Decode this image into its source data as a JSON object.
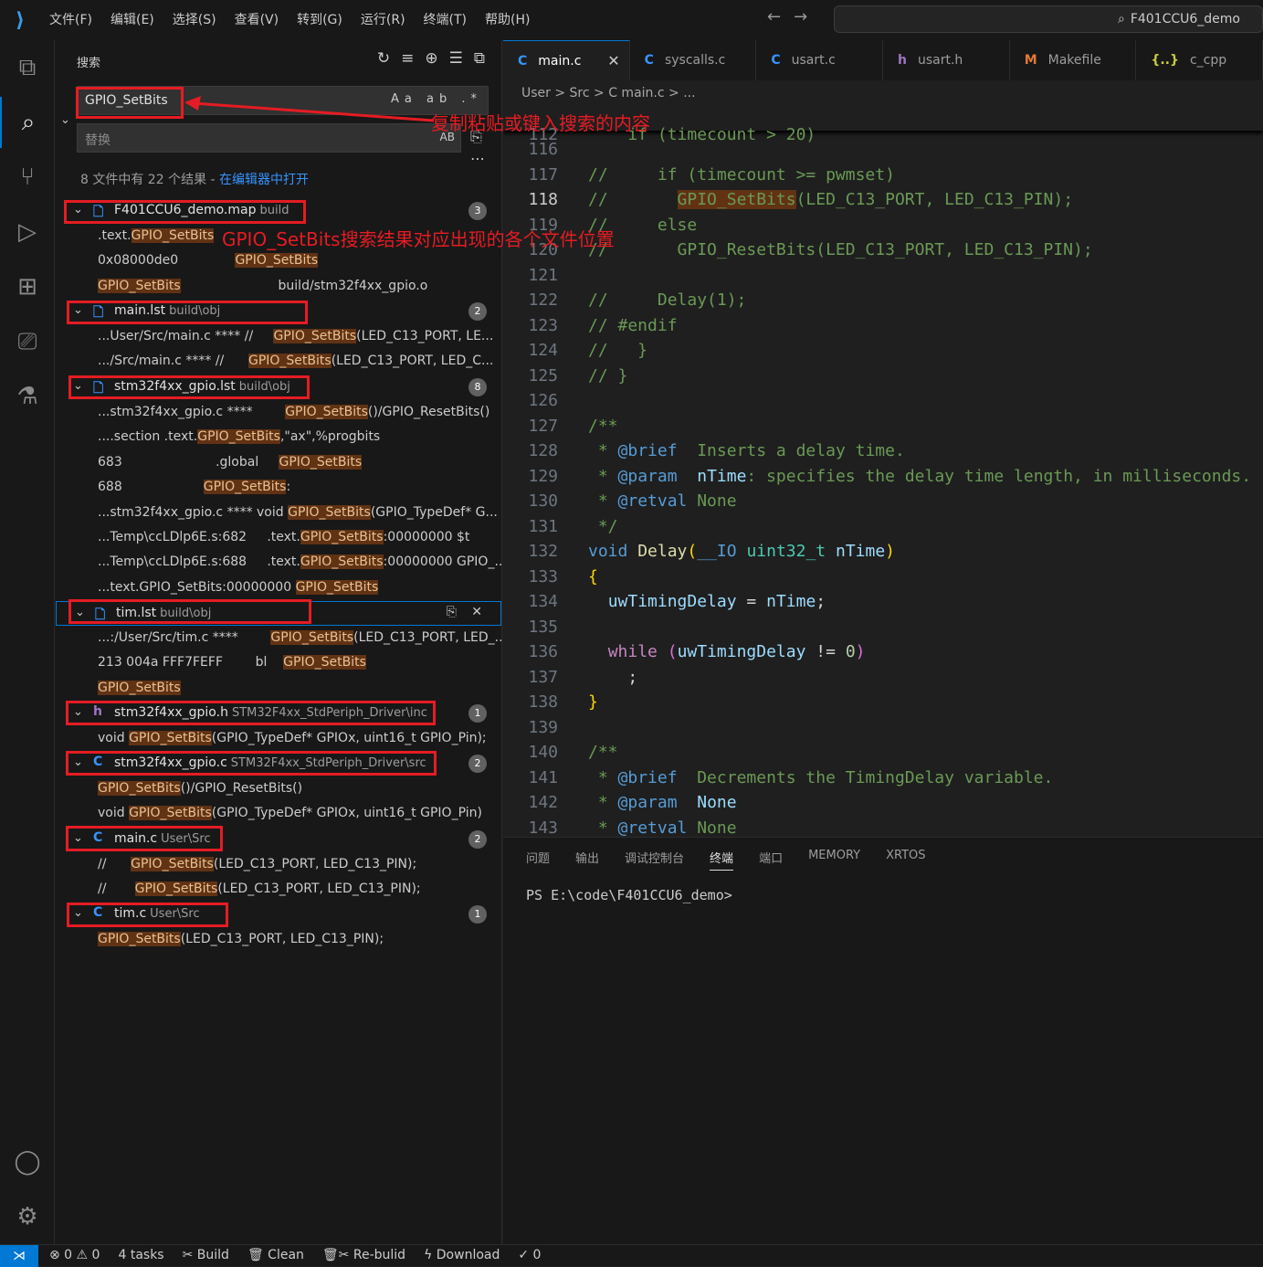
{
  "titlebar": {
    "menu": [
      "文件(F)",
      "编辑(E)",
      "选择(S)",
      "查看(V)",
      "转到(G)",
      "运行(R)",
      "终端(T)",
      "帮助(H)"
    ],
    "nav_back": "←",
    "nav_forward": "→",
    "command_center": "F401CCU6_demo"
  },
  "sidebar": {
    "title": "搜索",
    "search_value": "GPIO_SetBits",
    "search_opts": "Aa ab .*",
    "replace_placeholder": "替换",
    "replace_opt": "AB",
    "summary": "8 文件中有 22 个结果 - ",
    "summary_link": "在编辑器中打开",
    "files": [
      {
        "icon": "map",
        "name": "F401CCU6_demo.map",
        "path": "build",
        "count": "3",
        "lines": [
          {
            "pre": ".text.",
            "m": "GPIO_SetBits",
            "post": ""
          },
          {
            "pre": "0x08000de0              ",
            "m": "GPIO_SetBits",
            "post": ""
          },
          {
            "pre": "",
            "m": "GPIO_SetBits",
            "post": "                        build/stm32f4xx_gpio.o"
          }
        ]
      },
      {
        "icon": "lst",
        "name": "main.lst",
        "path": "build\\obj",
        "count": "2",
        "lines": [
          {
            "pre": "...User/Src/main.c **** //     ",
            "m": "GPIO_SetBits",
            "post": "(LED_C13_PORT, LE..."
          },
          {
            "pre": ".../Src/main.c **** //      ",
            "m": "GPIO_SetBits",
            "post": "(LED_C13_PORT, LED_C..."
          }
        ]
      },
      {
        "icon": "lst",
        "name": "stm32f4xx_gpio.lst",
        "path": "build\\obj",
        "count": "8",
        "lines": [
          {
            "pre": "...stm32f4xx_gpio.c ****        ",
            "m": "GPIO_SetBits",
            "post": "()/GPIO_ResetBits()"
          },
          {
            "pre": "....section .text.",
            "m": "GPIO_SetBits",
            "post": ",\"ax\",%progbits"
          },
          {
            "pre": "683                       .global     ",
            "m": "GPIO_SetBits",
            "post": ""
          },
          {
            "pre": "688                    ",
            "m": "GPIO_SetBits",
            "post": ":"
          },
          {
            "pre": "...stm32f4xx_gpio.c **** void ",
            "m": "GPIO_SetBits",
            "post": "(GPIO_TypeDef* G..."
          },
          {
            "pre": "...Temp\\ccLDlp6E.s:682     .text.",
            "m": "GPIO_SetBits",
            "post": ":00000000 $t"
          },
          {
            "pre": "...Temp\\ccLDlp6E.s:688     .text.",
            "m": "GPIO_SetBits",
            "post": ":00000000 GPIO_..."
          },
          {
            "pre": "...text.GPIO_SetBits:00000000 ",
            "m": "GPIO_SetBits",
            "post": ""
          }
        ]
      },
      {
        "icon": "lst",
        "name": "tim.lst",
        "path": "build\\obj",
        "count": "",
        "lines": [
          {
            "pre": "...:/User/Src/tim.c ****        ",
            "m": "GPIO_SetBits",
            "post": "(LED_C13_PORT, LED_..."
          },
          {
            "pre": "213 004a FFF7FEFF        bl    ",
            "m": "GPIO_SetBits",
            "post": ""
          },
          {
            "pre": "",
            "m": "GPIO_SetBits",
            "post": ""
          }
        ]
      },
      {
        "icon": "h",
        "name": "stm32f4xx_gpio.h",
        "path": "STM32F4xx_StdPeriph_Driver\\inc",
        "count": "1",
        "lines": [
          {
            "pre": "void ",
            "m": "GPIO_SetBits",
            "post": "(GPIO_TypeDef* GPIOx, uint16_t GPIO_Pin);"
          }
        ]
      },
      {
        "icon": "c",
        "name": "stm32f4xx_gpio.c",
        "path": "STM32F4xx_StdPeriph_Driver\\src",
        "count": "2",
        "lines": [
          {
            "pre": "",
            "m": "GPIO_SetBits",
            "post": "()/GPIO_ResetBits()"
          },
          {
            "pre": "void ",
            "m": "GPIO_SetBits",
            "post": "(GPIO_TypeDef* GPIOx, uint16_t GPIO_Pin)"
          }
        ]
      },
      {
        "icon": "c",
        "name": "main.c",
        "path": "User\\Src",
        "count": "2",
        "lines": [
          {
            "pre": "//      ",
            "m": "GPIO_SetBits",
            "post": "(LED_C13_PORT, LED_C13_PIN);"
          },
          {
            "pre": "//       ",
            "m": "GPIO_SetBits",
            "post": "(LED_C13_PORT, LED_C13_PIN);"
          }
        ]
      },
      {
        "icon": "c",
        "name": "tim.c",
        "path": "User\\Src",
        "count": "1",
        "lines": [
          {
            "pre": "",
            "m": "GPIO_SetBits",
            "post": "(LED_C13_PORT, LED_C13_PIN);"
          }
        ]
      }
    ]
  },
  "annotations": {
    "copy_paste": "复制粘贴或键入搜索的内容",
    "results": "GPIO_SetBits搜索结果对应出现的各个文件位置"
  },
  "tabs": [
    {
      "icon": "C",
      "label": "main.c",
      "active": true
    },
    {
      "icon": "C",
      "label": "syscalls.c"
    },
    {
      "icon": "C",
      "label": "usart.c"
    },
    {
      "icon": "h",
      "label": "usart.h"
    },
    {
      "icon": "M",
      "label": "Makefile"
    },
    {
      "icon": "{..}",
      "label": "c_cpp"
    }
  ],
  "breadcrumb": "User  >  Src  >  C  main.c  >  ...",
  "code_sticky": "    if (timecount > 20)",
  "panel": {
    "tabs": [
      "问题",
      "输出",
      "调试控制台",
      "终端",
      "端口",
      "MEMORY",
      "XRTOS"
    ],
    "active_tab": "终端",
    "terminal_line": "PS E:\\code\\F401CCU6_demo>"
  },
  "status": {
    "errors": "⊗ 0",
    "warnings": "⚠ 0",
    "tasks": "4 tasks",
    "build": "Build",
    "clean": "Clean",
    "rebuild": "Re-bulid",
    "download": "Download",
    "check": "✓ 0"
  },
  "colors": {
    "accent": "#0078d4",
    "highlight": "#613214",
    "annotation": "#e51c23"
  }
}
